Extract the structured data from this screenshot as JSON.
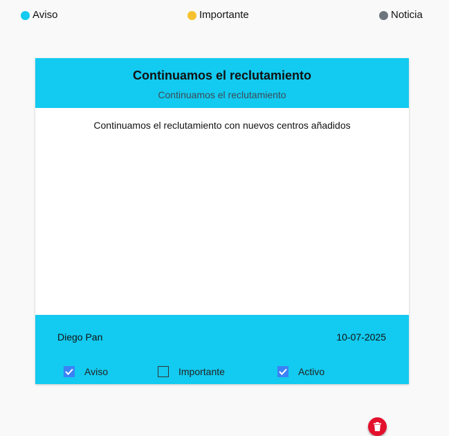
{
  "legend": {
    "items": [
      {
        "label": "Aviso",
        "color": "#13caf0"
      },
      {
        "label": "Importante",
        "color": "#f6c12f"
      },
      {
        "label": "Noticia",
        "color": "#6c757d"
      }
    ]
  },
  "card": {
    "color": "#13caf0",
    "title": "Continuamos el reclutamiento",
    "subtitle": "Continuamos el reclutamiento",
    "body": "Continuamos el reclutamiento con nuevos centros añadidos",
    "author": "Diego Pan",
    "date": "10-07-2025",
    "checks": [
      {
        "label": "Aviso",
        "checked": true
      },
      {
        "label": "Importante",
        "checked": false
      },
      {
        "label": "Activo",
        "checked": true
      }
    ],
    "delete_icon": "trash-icon",
    "delete_color": "#e3102c"
  }
}
